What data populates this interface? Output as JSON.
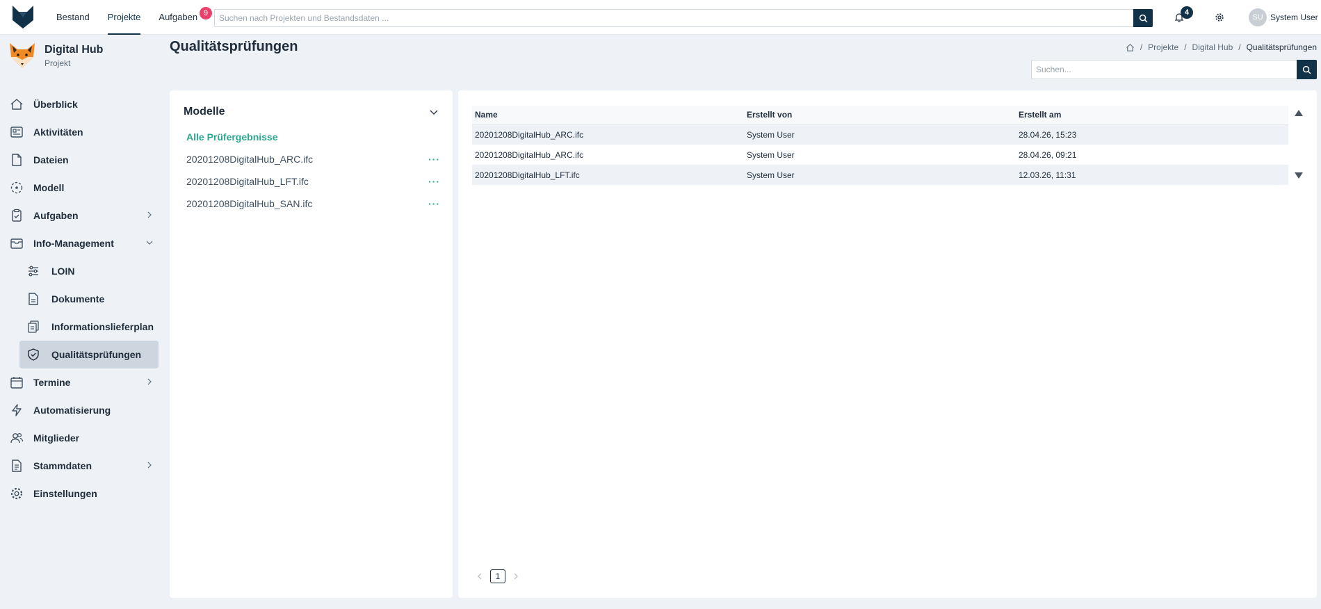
{
  "topnav": {
    "items": [
      {
        "label": "Bestand"
      },
      {
        "label": "Projekte"
      },
      {
        "label": "Aufgaben",
        "badge": "9"
      }
    ],
    "search_placeholder": "Suchen nach Projekten und Bestandsdaten ...",
    "notification_count": "4",
    "user": {
      "initials": "SU",
      "name": "System User"
    }
  },
  "project": {
    "title": "Digital Hub",
    "subtitle": "Projekt"
  },
  "sidebar": {
    "items": [
      {
        "label": "Überblick"
      },
      {
        "label": "Aktivitäten"
      },
      {
        "label": "Dateien"
      },
      {
        "label": "Modell"
      },
      {
        "label": "Aufgaben"
      },
      {
        "label": "Info-Management"
      },
      {
        "label": "LOIN"
      },
      {
        "label": "Dokumente"
      },
      {
        "label": "Informationslieferplan"
      },
      {
        "label": "Qualitätsprüfungen"
      },
      {
        "label": "Termine"
      },
      {
        "label": "Automatisierung"
      },
      {
        "label": "Mitglieder"
      },
      {
        "label": "Stammdaten"
      },
      {
        "label": "Einstellungen"
      }
    ]
  },
  "page": {
    "title": "Qualitätsprüfungen",
    "breadcrumb": [
      "Projekte",
      "Digital Hub",
      "Qualitätsprüfungen"
    ],
    "search_placeholder": "Suchen..."
  },
  "models": {
    "title": "Modelle",
    "all_label": "Alle Prüfergebnisse",
    "items": [
      {
        "name": "20201208DigitalHub_ARC.ifc",
        "menu": "···"
      },
      {
        "name": "20201208DigitalHub_LFT.ifc",
        "menu": "···"
      },
      {
        "name": "20201208DigitalHub_SAN.ifc",
        "menu": "···"
      }
    ]
  },
  "table": {
    "columns": [
      "Name",
      "Erstellt von",
      "Erstellt am"
    ],
    "rows": [
      [
        "20201208DigitalHub_ARC.ifc",
        "System User",
        "28.04.26, 15:23"
      ],
      [
        "20201208DigitalHub_ARC.ifc",
        "System User",
        "28.04.26, 09:21"
      ],
      [
        "20201208DigitalHub_LFT.ifc",
        "System User",
        "12.03.26, 11:31"
      ]
    ]
  },
  "pagination": {
    "current_page": "1"
  },
  "colors": {
    "primary": "#12324a",
    "accent": "#2aa78d",
    "badge": "#e8416b",
    "active_bg": "#cdd5df"
  }
}
